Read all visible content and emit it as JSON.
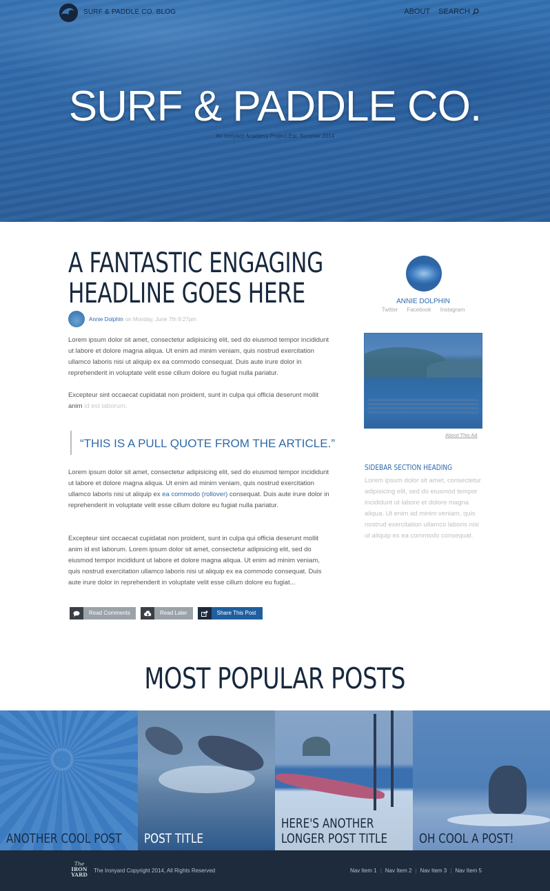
{
  "header": {
    "blog_name": "SURF & PADDLE CO. BLOG",
    "nav_about": "ABOUT",
    "nav_search": "SEARCH"
  },
  "hero": {
    "title": "SURF & PADDLE CO.",
    "subtitle": "An Ironyard Academy Project Est. Summer 2014"
  },
  "article": {
    "headline_line1": "A FANTASTIC ENGAGING",
    "headline_line2": "HEADLINE GOES HERE",
    "author": "Annie Dolphin",
    "date": "on Monday, June 7th 9:27pm",
    "p1": "Lorem ipsum dolor sit amet, consectetur adipisicing elit, sed do eiusmod tempor incididunt ut labore et dolore magna aliqua. Ut enim ad minim veniam, quis nostrud exercitation ullamco laboris nisi ut aliquip ex ea commodo consequat. Duis aute irure dolor in reprehenderit in voluptate velit esse cillum dolore eu fugiat nulla pariatur.",
    "p2_main": "Excepteur sint occaecat cupidatat non proident, sunt in culpa qui officia deserunt mollit anim ",
    "p2_fade": "id est laborum.",
    "pull_quote": "“THIS IS A PULL QUOTE FROM THE ARTICLE.”",
    "p3_before": "Lorem ipsum dolor sit amet, consectetur adipisicing elit, sed do eiusmod tempor incididunt ut labore et dolore magna aliqua. Ut enim ad minim veniam, quis nostrud exercitation ullamco laboris nisi ut aliquip ex ",
    "p3_link": "ea commodo (rollover)",
    "p3_after": " consequat. Duis aute irure dolor in reprehenderit in voluptate velit esse cillum dolore eu fugiat nulla pariatur.",
    "p4": "Excepteur sint occaecat cupidatat non proident, sunt in culpa qui officia deserunt mollit anim id est laborum. Lorem ipsum dolor sit amet, consectetur adipisicing elit, sed do eiusmod tempor incididunt ut labore et dolore magna aliqua. Ut enim ad minim veniam, quis nostrud exercitation ullamco laboris nisi ut aliquip ex ea commodo consequat. Duis aute irure dolor in reprehenderit in voluptate velit esse cillum dolore eu fugiat...",
    "buttons": {
      "read_comments": "Read Comments",
      "read_later": "Read Later",
      "share": "Share This Post"
    }
  },
  "sidebar": {
    "author_name": "ANNIE DOLPHIN",
    "social": [
      "Twitter",
      "Facebook",
      "Instagram"
    ],
    "ad_link": "About This Ad",
    "section_heading": "SIDEBAR SECTION HEADING",
    "section_text": "Lorem ipsum dolor sit amet, consectetur adipisicing elit, sed do eiusmod tempor incididunt ut labore et dolore magna aliqua. Ut enim ad minim veniam, quis nostrud exercitation ullamco laboris nisi ut aliquip ex ea commodo consequat."
  },
  "popular": {
    "title": "MOST POPULAR POSTS",
    "posts": [
      {
        "line1": "ANOTHER COOL POST",
        "line2": ""
      },
      {
        "line1": "POST TITLE",
        "line2": ""
      },
      {
        "line1": "HERE'S ANOTHER",
        "line2": "LONGER POST TITLE"
      },
      {
        "line1": "OH COOL A POST!",
        "line2": ""
      }
    ]
  },
  "footer": {
    "logo_line1": "The",
    "logo_line2": "IRON",
    "logo_line3": "YARD",
    "copyright": "The Ironyard Copyright 2014, All Rights Reserved",
    "nav": [
      "Nav Item 1",
      "Nav Item 2",
      "Nav Item 3",
      "Nav Item 5"
    ]
  },
  "colors": {
    "brand_blue": "#2e6aaa",
    "navy": "#17283d",
    "footer_bg": "#1d2b3d"
  }
}
